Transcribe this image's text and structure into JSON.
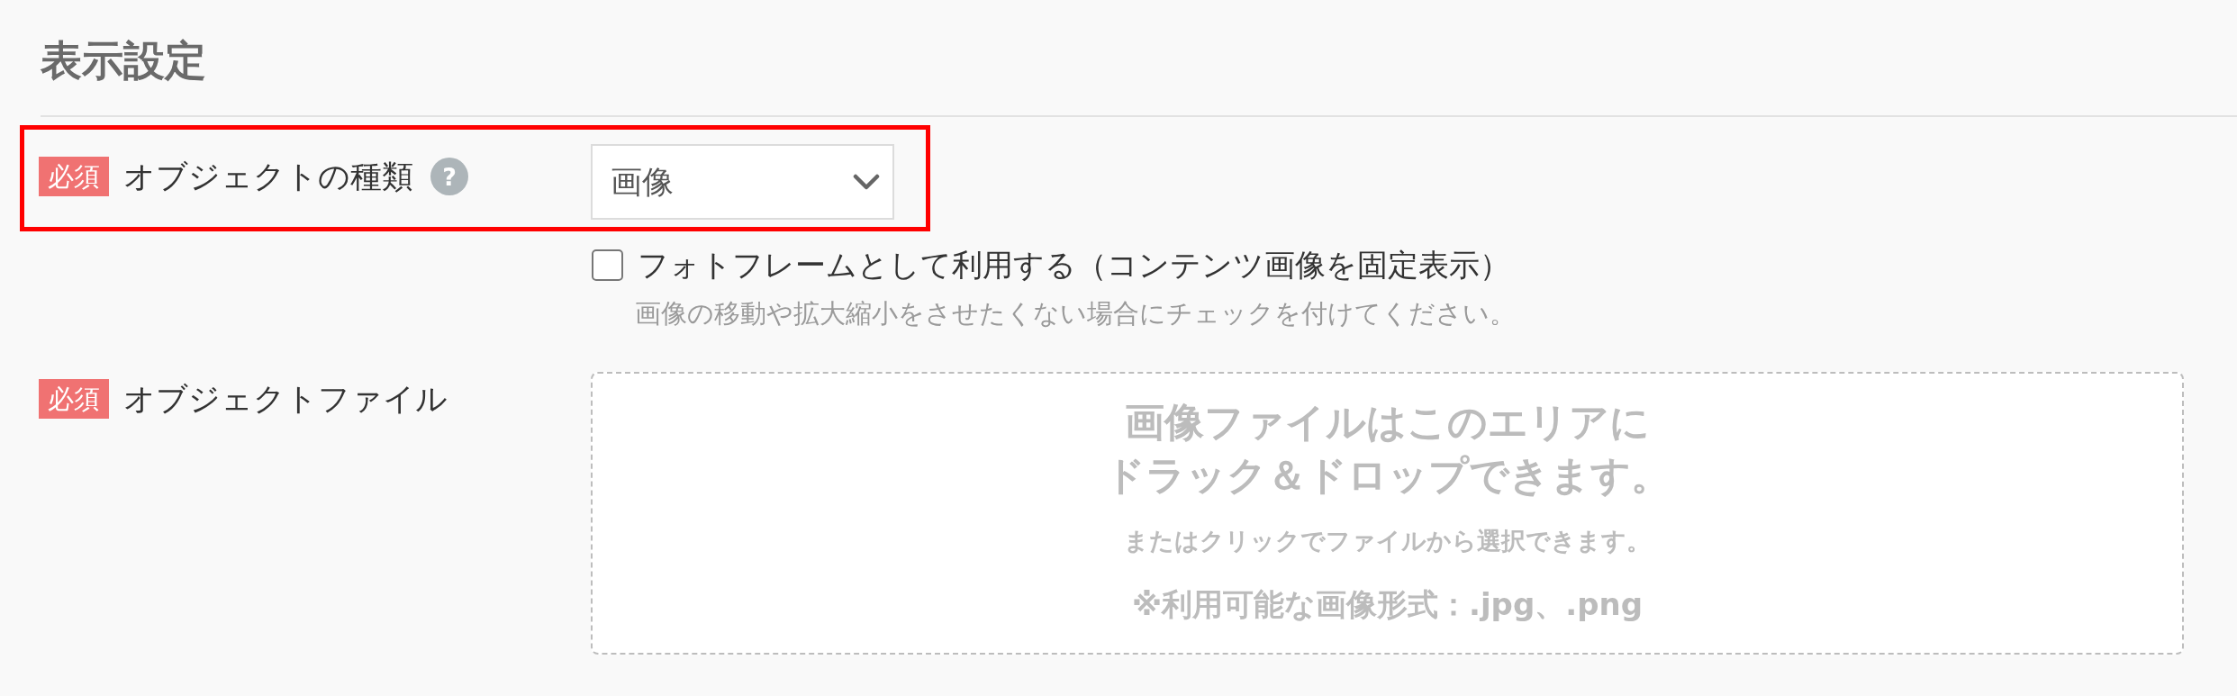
{
  "section": {
    "title": "表示設定"
  },
  "fields": [
    {
      "kind": "select",
      "badge": "必須",
      "label": "オブジェクトの種類",
      "help": "?",
      "highlighted": true,
      "value": "画像",
      "checkbox": {
        "label": "フォトフレームとして利用する（コンテンツ画像を固定表示）",
        "checked": false
      },
      "hint": "画像の移動や拡大縮小をさせたくない場合にチェックを付けてください。"
    },
    {
      "kind": "dropzone",
      "badge": "必須",
      "label": "オブジェクトファイル",
      "highlighted": false,
      "dropzone": {
        "heading_lines": [
          "画像ファイルはこのエリアに",
          "ドラック＆ドロップできます。"
        ],
        "subtext": "またはクリックでファイルから選択できます。",
        "formats": "※利用可能な画像形式：.jpg、.png"
      }
    }
  ]
}
